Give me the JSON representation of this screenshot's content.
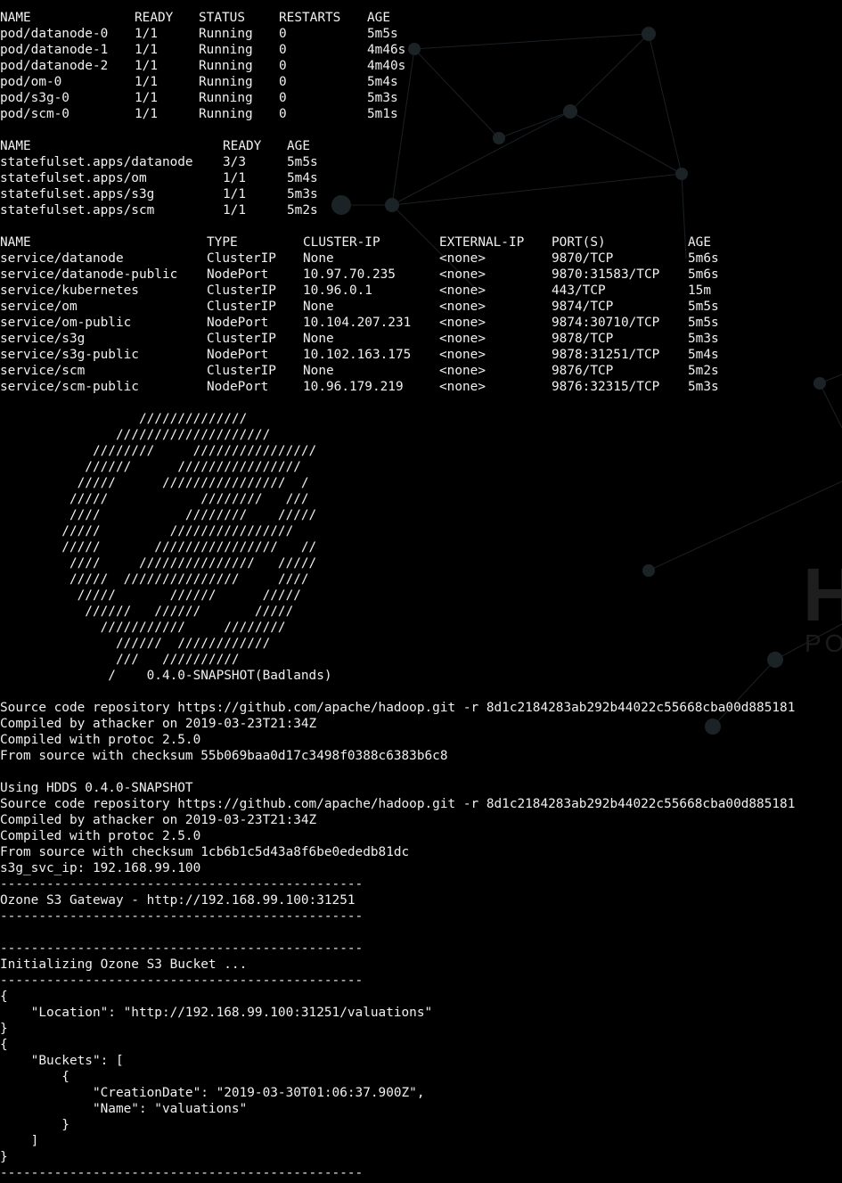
{
  "watermark": {
    "big_letter": "H",
    "small_letters": "PO"
  },
  "pods": {
    "headers": [
      "NAME",
      "READY",
      "STATUS",
      "RESTARTS",
      "AGE"
    ],
    "rows": [
      [
        "pod/datanode-0",
        "1/1",
        "Running",
        "0",
        "5m5s"
      ],
      [
        "pod/datanode-1",
        "1/1",
        "Running",
        "0",
        "4m46s"
      ],
      [
        "pod/datanode-2",
        "1/1",
        "Running",
        "0",
        "4m40s"
      ],
      [
        "pod/om-0",
        "1/1",
        "Running",
        "0",
        "5m4s"
      ],
      [
        "pod/s3g-0",
        "1/1",
        "Running",
        "0",
        "5m3s"
      ],
      [
        "pod/scm-0",
        "1/1",
        "Running",
        "0",
        "5m1s"
      ]
    ]
  },
  "statefulsets": {
    "headers": [
      "NAME",
      "READY",
      "AGE"
    ],
    "rows": [
      [
        "statefulset.apps/datanode",
        "3/3",
        "5m5s"
      ],
      [
        "statefulset.apps/om",
        "1/1",
        "5m4s"
      ],
      [
        "statefulset.apps/s3g",
        "1/1",
        "5m3s"
      ],
      [
        "statefulset.apps/scm",
        "1/1",
        "5m2s"
      ]
    ]
  },
  "services": {
    "headers": [
      "NAME",
      "TYPE",
      "CLUSTER-IP",
      "EXTERNAL-IP",
      "PORT(S)",
      "AGE"
    ],
    "rows": [
      [
        "service/datanode",
        "ClusterIP",
        "None",
        "<none>",
        "9870/TCP",
        "5m6s"
      ],
      [
        "service/datanode-public",
        "NodePort",
        "10.97.70.235",
        "<none>",
        "9870:31583/TCP",
        "5m6s"
      ],
      [
        "service/kubernetes",
        "ClusterIP",
        "10.96.0.1",
        "<none>",
        "443/TCP",
        "15m"
      ],
      [
        "service/om",
        "ClusterIP",
        "None",
        "<none>",
        "9874/TCP",
        "5m5s"
      ],
      [
        "service/om-public",
        "NodePort",
        "10.104.207.231",
        "<none>",
        "9874:30710/TCP",
        "5m5s"
      ],
      [
        "service/s3g",
        "ClusterIP",
        "None",
        "<none>",
        "9878/TCP",
        "5m3s"
      ],
      [
        "service/s3g-public",
        "NodePort",
        "10.102.163.175",
        "<none>",
        "9878:31251/TCP",
        "5m4s"
      ],
      [
        "service/scm",
        "ClusterIP",
        "None",
        "<none>",
        "9876/TCP",
        "5m2s"
      ],
      [
        "service/scm-public",
        "NodePort",
        "10.96.179.219",
        "<none>",
        "9876:32315/TCP",
        "5m3s"
      ]
    ]
  },
  "banner": [
    "                  //////////////",
    "               ////////////////////",
    "            ////////     ////////////////",
    "           //////      ////////////////",
    "          /////      ////////////////  /",
    "         /////            ////////   ///",
    "         ////           ////////    /////",
    "        /////         ////////////////",
    "        /////       ////////////////   //",
    "         ////     ///////////////   /////",
    "         /////  ///////////////     ////",
    "          /////       //////      /////",
    "           //////   //////       /////",
    "             ///////////     ////////",
    "               //////  ////////////",
    "               ///   //////////",
    "              /    0.4.0-SNAPSHOT(Badlands)"
  ],
  "log_lines": [
    "",
    "Source code repository https://github.com/apache/hadoop.git -r 8d1c2184283ab292b44022c55668cba00d885181",
    "Compiled by athacker on 2019-03-23T21:34Z",
    "Compiled with protoc 2.5.0",
    "From source with checksum 55b069baa0d17c3498f0388c6383b6c8",
    "",
    "Using HDDS 0.4.0-SNAPSHOT",
    "Source code repository https://github.com/apache/hadoop.git -r 8d1c2184283ab292b44022c55668cba00d885181",
    "Compiled by athacker on 2019-03-23T21:34Z",
    "Compiled with protoc 2.5.0",
    "From source with checksum 1cb6b1c5d43a8f6be0ededb81dc",
    "s3g_svc_ip: 192.168.99.100",
    "-----------------------------------------------",
    "Ozone S3 Gateway - http://192.168.99.100:31251",
    "-----------------------------------------------",
    "",
    "-----------------------------------------------",
    "Initializing Ozone S3 Bucket ...",
    "-----------------------------------------------",
    "{",
    "    \"Location\": \"http://192.168.99.100:31251/valuations\"",
    "}",
    "{",
    "    \"Buckets\": [",
    "        {",
    "            \"CreationDate\": \"2019-03-30T01:06:37.900Z\",",
    "            \"Name\": \"valuations\"",
    "        }",
    "    ]",
    "}",
    "-----------------------------------------------"
  ]
}
